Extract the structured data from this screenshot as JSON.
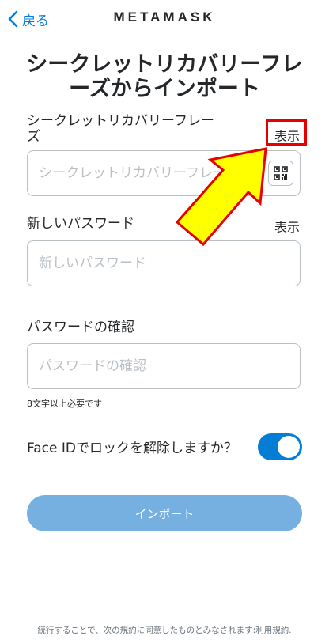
{
  "nav": {
    "back_label": "戻る",
    "brand": "METAMASK"
  },
  "title": "シークレットリカバリーフレーズからインポート",
  "srp": {
    "label_line1": "シークレットリカバリーフレー",
    "label_line2": "ズ",
    "show_label": "表示",
    "placeholder": "シークレットリカバリーフレーズ"
  },
  "new_password": {
    "label": "新しいパスワード",
    "show_label": "表示",
    "placeholder": "新しいパスワード"
  },
  "confirm_password": {
    "label": "パスワードの確認",
    "placeholder": "パスワードの確認"
  },
  "password_hint": "8文字以上必要です",
  "face_id": {
    "label": "Face IDでロックを解除しますか？",
    "enabled": true
  },
  "import_button": "インポート",
  "footer": {
    "text": "続行することで、次の規約に同意したものとみなされます:",
    "link": "利用規約",
    "suffix": "."
  },
  "colors": {
    "accent": "#037dd6",
    "button_disabled": "#75b0e0",
    "annotation_red": "#e60000",
    "annotation_yellow": "#ffff00"
  },
  "icons": {
    "back": "chevron-left-icon",
    "qr": "qr-code-icon",
    "annotation": "arrow-pointer-icon"
  }
}
